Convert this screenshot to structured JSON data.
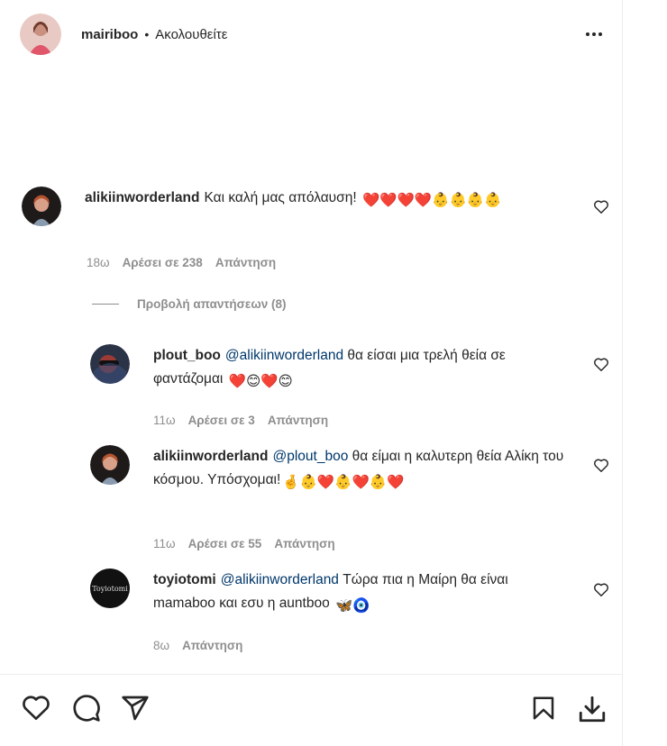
{
  "post": {
    "author": "mairiboo",
    "separator": "•",
    "follow_status": "Ακολουθείτε"
  },
  "comments": [
    {
      "user": "alikiinworderland",
      "text_before": "",
      "mention": "",
      "text": "Και καλή μας απόλαυση!",
      "emojis": "❤️❤️❤️❤️👶👶👶👶",
      "time": "18ω",
      "likes": "Αρέσει σε 238",
      "reply": "Απάντηση"
    }
  ],
  "view_replies": "Προβολή απαντήσεων (8)",
  "replies": [
    {
      "user": "plout_boo",
      "mention": "@alikiinworderland",
      "text": "θα είσαι μια τρελή θεία σε φαντάζομαι",
      "emojis": "❤️😊❤️😊",
      "time": "11ω",
      "likes": "Αρέσει σε 3",
      "reply": "Απάντηση"
    },
    {
      "user": "alikiinworderland",
      "mention": "@plout_boo",
      "text": "θα είμαι η καλυτερη θεία Αλίκη του κόσμου. Υπόσχομαι!",
      "emojis": "🤞👶❤️👶❤️👶❤️",
      "time": "11ω",
      "likes": "Αρέσει σε 55",
      "reply": "Απάντηση"
    },
    {
      "user": "toyiotomi",
      "mention": "@alikiinworderland",
      "text": "Τώρα πια η Μαίρη θα είναι mamaboo και εσυ η auntboo",
      "emojis": "🦋🧿",
      "time": "8ω",
      "reply": "Απάντηση",
      "avatar_text": "Toyiotomi"
    }
  ],
  "icons": {
    "more": "more-options-icon",
    "like_comment": "heart-outline-icon",
    "like_post": "heart-icon",
    "comment": "comment-icon",
    "share": "paper-plane-icon",
    "save": "bookmark-icon",
    "download": "download-icon"
  },
  "colors": {
    "text": "#262626",
    "secondary": "#8e8e8e",
    "mention": "#00376b",
    "heart": "#e0245e"
  }
}
